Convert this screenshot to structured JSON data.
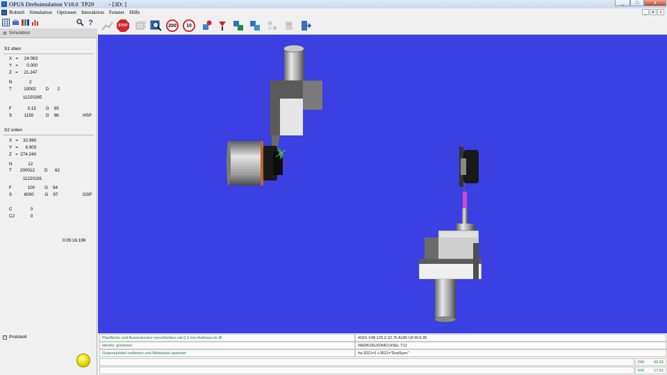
{
  "window": {
    "title": "OPUS Drehsimulation V18.0  TP29          - [3D: ]",
    "controls": [
      "_",
      "□",
      "x"
    ],
    "mdi_controls": [
      "_",
      "ø",
      "x"
    ]
  },
  "menu": {
    "items": [
      "Rohteil",
      "Simulation",
      "Optionen",
      "Interaktion",
      "Fenster",
      "Hilfe"
    ]
  },
  "toolbar": {
    "stop_label": "STOP",
    "speed1_label": "200",
    "speed2_label": "10"
  },
  "left_panel": {
    "tab_label": "Simulation",
    "s1": {
      "title": "S1 oben",
      "x": "X   =     24.063",
      "y": "Y   =       0.000",
      "z": "Z   =     21.247",
      "n": "N              2",
      "t": "T          10002        D       2",
      "id": "11220265",
      "f": "F             0.15        G    95",
      "s": "S          1150          G    96",
      "mode": "HSP"
    },
    "s2": {
      "title": "S2 unten",
      "x": "X   =    32.960",
      "y": "Y   =      6.903",
      "z": "Z   =  274.240",
      "n": "N             12",
      "t": "T       200012        D      62",
      "id": "11220191",
      "f": "F             100        G    94",
      "s": "S          6000         G    97",
      "mode": "GSP",
      "c": "C               0",
      "c2": "C2             0"
    },
    "time": "0:05:16.196",
    "protokoll_label": "Protokoll",
    "protokoll_checked": "✓"
  },
  "bottom": {
    "messages": [
      "Planfläche und Aussenkontur vorschlichten mit 0.2 mm Aufmass im Ø",
      "Identnr. gravieren",
      "Gegenspindel vorfahren und Werkstück spannen"
    ],
    "codes": [
      "#G01 X48.125 Z-22.75 A180 U0 W-6.35",
      "WERKZEUGWECHSEL T12",
      "#a-3021=1 t-3021=\"EndSync\""
    ],
    "dw_label": "DW",
    "dw_value": "93.03",
    "kw_label": "KW",
    "kw_value": "17.01"
  },
  "colors": {
    "viewport_bg": "#3b40e2",
    "status_text": "#1a7a3c",
    "stop_red": "#d4232b"
  }
}
